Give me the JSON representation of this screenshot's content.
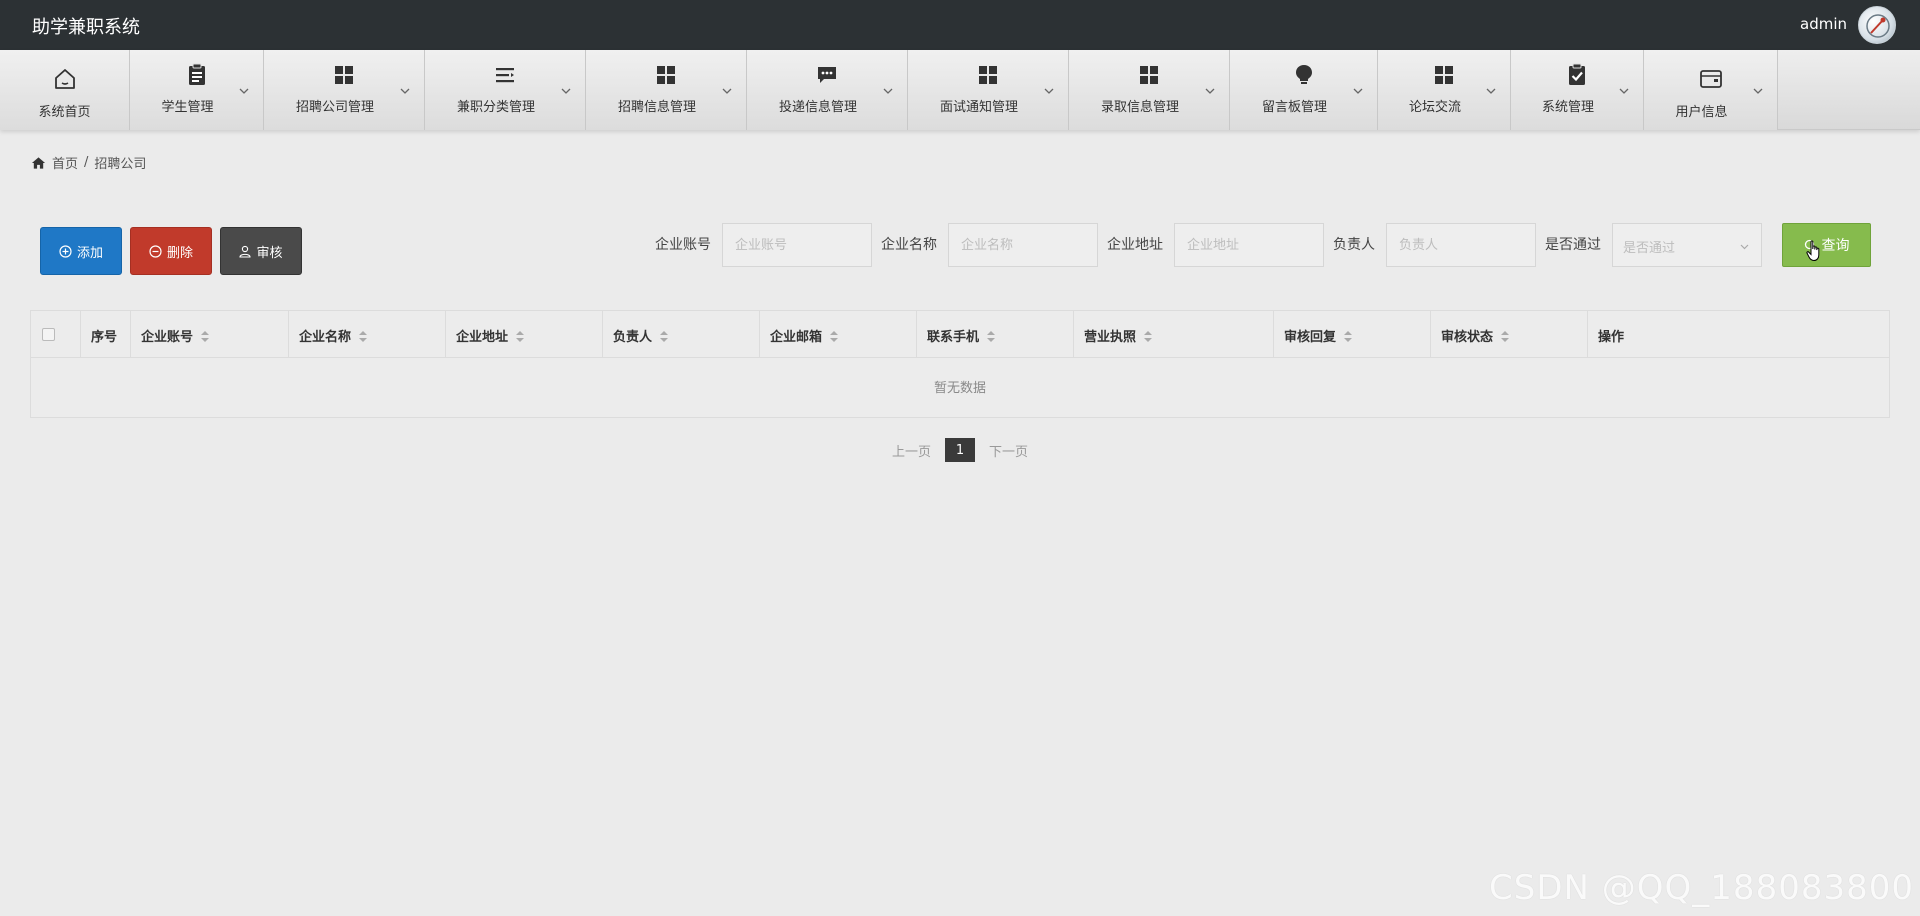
{
  "header": {
    "app_title": "助学兼职系统",
    "user_name": "admin"
  },
  "nav": {
    "items": [
      {
        "label": "系统首页",
        "icon": "home-icon"
      },
      {
        "label": "学生管理",
        "icon": "clipboard-icon"
      },
      {
        "label": "招聘公司管理",
        "icon": "grid-icon"
      },
      {
        "label": "兼职分类管理",
        "icon": "list-icon"
      },
      {
        "label": "招聘信息管理",
        "icon": "grid-icon"
      },
      {
        "label": "投递信息管理",
        "icon": "chat-icon"
      },
      {
        "label": "面试通知管理",
        "icon": "grid-icon"
      },
      {
        "label": "录取信息管理",
        "icon": "grid-icon"
      },
      {
        "label": "留言板管理",
        "icon": "bulb-icon"
      },
      {
        "label": "论坛交流",
        "icon": "grid-icon"
      },
      {
        "label": "系统管理",
        "icon": "clipboard-check-icon"
      },
      {
        "label": "用户信息",
        "icon": "card-icon"
      }
    ]
  },
  "breadcrumb": {
    "home": "首页",
    "separator": "/",
    "current": "招聘公司"
  },
  "actions": {
    "add": "添加",
    "delete": "删除",
    "audit": "审核"
  },
  "search": {
    "account_label": "企业账号",
    "account_placeholder": "企业账号",
    "name_label": "企业名称",
    "name_placeholder": "企业名称",
    "address_label": "企业地址",
    "address_placeholder": "企业地址",
    "manager_label": "负责人",
    "manager_placeholder": "负责人",
    "passed_label": "是否通过",
    "passed_placeholder": "是否通过",
    "query": "查询"
  },
  "table": {
    "columns": [
      "序号",
      "企业账号",
      "企业名称",
      "企业地址",
      "负责人",
      "企业邮箱",
      "联系手机",
      "营业执照",
      "审核回复",
      "审核状态",
      "操作"
    ],
    "empty_text": "暂无数据"
  },
  "pager": {
    "prev": "上一页",
    "current": "1",
    "next": "下一页"
  },
  "watermark": "CSDN @QQ_188083800",
  "colors": {
    "header_bg": "#2c3134",
    "add": "#1f78c6",
    "delete": "#c13a2b",
    "audit": "#4a4a4a",
    "query": "#86bb4d"
  }
}
